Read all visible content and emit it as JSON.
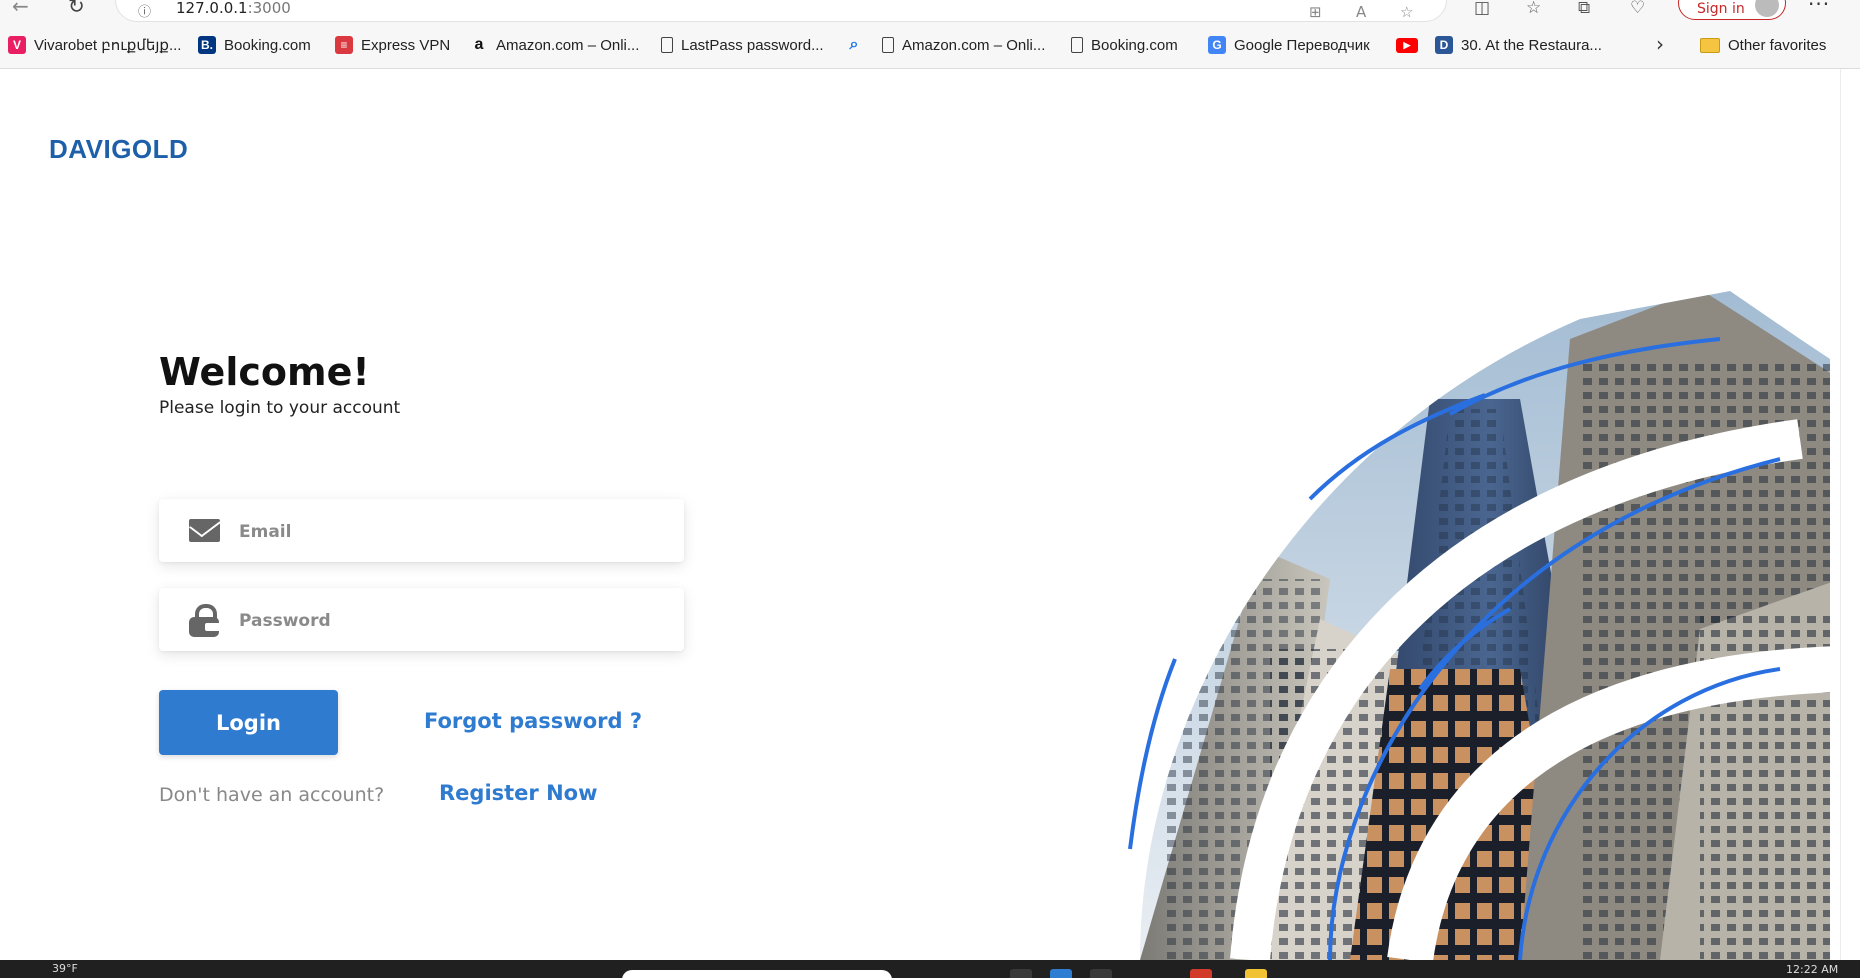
{
  "browser": {
    "url_host": "127.0.0.1",
    "url_port": ":3000",
    "signin_label": "Sign in",
    "more_label": "···",
    "icons": [
      "back-arrow-icon",
      "reload-icon",
      "info-icon",
      "apps-icon",
      "read-aloud-icon",
      "favorite-star-icon",
      "split-screen-icon",
      "favorites-icon",
      "collections-icon",
      "heart-pulse-icon"
    ]
  },
  "bookmarks": [
    {
      "label": "Vivarobet բուքմեյք...",
      "icon": "vivarobet",
      "color": "#e91e63"
    },
    {
      "label": "Booking.com",
      "icon": "booking",
      "color": "#003580"
    },
    {
      "label": "Express VPN",
      "icon": "expressvpn",
      "color": "#da3940"
    },
    {
      "label": "Amazon.com – Onli...",
      "icon": "amazon",
      "color": "#111111"
    },
    {
      "label": "LastPass password...",
      "icon": "document",
      "color": "#444444"
    },
    {
      "label": "",
      "icon": "search",
      "color": "#1a73e8"
    },
    {
      "label": "Amazon.com – Onli...",
      "icon": "document",
      "color": "#444444"
    },
    {
      "label": "Booking.com",
      "icon": "document",
      "color": "#444444"
    },
    {
      "label": "Google Переводчик",
      "icon": "google-translate",
      "color": "#4285f4"
    },
    {
      "label": "",
      "icon": "youtube",
      "color": "#ff0000"
    },
    {
      "label": "30. At the Restaura...",
      "icon": "dictionary",
      "color": "#2b5797"
    }
  ],
  "other_favorites": "Other favorites",
  "page": {
    "logo": "DAVIGOLD",
    "heading": "Welcome!",
    "subheading": "Please login to your account",
    "email_placeholder": "Email",
    "email_value": "",
    "password_placeholder": "Password",
    "password_value": "",
    "login_label": "Login",
    "forgot_label": "Forgot password ?",
    "no_account_text": "Don't have an account?",
    "register_label": "Register Now"
  },
  "taskbar": {
    "weather": "39°F",
    "clock": "12:22 AM"
  },
  "colors": {
    "brand": "#1d5fa8",
    "accent": "#2f7bd0",
    "arc_blue": "#2a6fe0"
  }
}
